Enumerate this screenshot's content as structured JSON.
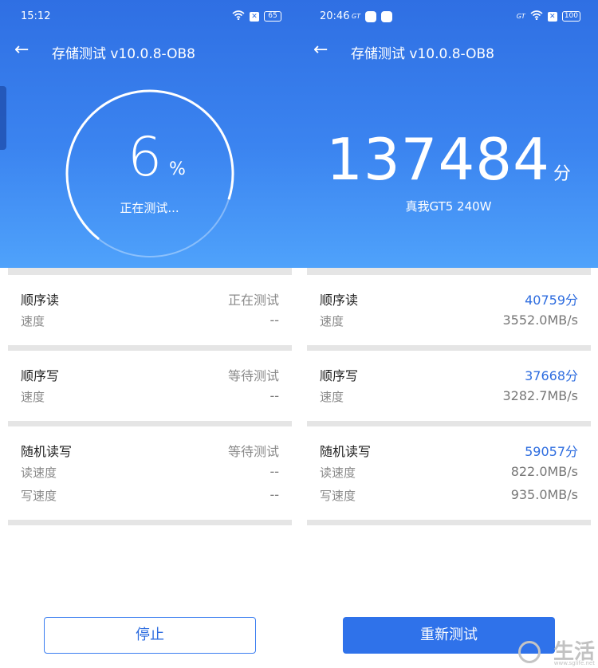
{
  "left": {
    "status_time": "15:12",
    "battery": "65",
    "title": "存储测试 v10.0.8-OB8",
    "progress_value": "6",
    "progress_unit": "%",
    "progress_fraction": 0.06,
    "testing_text": "正在测试...",
    "cards": [
      {
        "name": "顺序读",
        "status": "正在测试",
        "rows": [
          {
            "label": "速度",
            "value": "--"
          }
        ]
      },
      {
        "name": "顺序写",
        "status": "等待测试",
        "rows": [
          {
            "label": "速度",
            "value": "--"
          }
        ]
      },
      {
        "name": "随机读写",
        "status": "等待测试",
        "rows": [
          {
            "label": "读速度",
            "value": "--"
          },
          {
            "label": "写速度",
            "value": "--"
          }
        ]
      }
    ],
    "button_label": "停止"
  },
  "right": {
    "status_time": "20:46",
    "battery": "100",
    "title": "存储测试 v10.0.8-OB8",
    "total_score": "137484",
    "score_unit": "分",
    "device_name": "真我GT5 240W",
    "cards": [
      {
        "name": "顺序读",
        "score": "40759分",
        "rows": [
          {
            "label": "速度",
            "value": "3552.0MB/s"
          }
        ]
      },
      {
        "name": "顺序写",
        "score": "37668分",
        "rows": [
          {
            "label": "速度",
            "value": "3282.7MB/s"
          }
        ]
      },
      {
        "name": "随机读写",
        "score": "59057分",
        "rows": [
          {
            "label": "读速度",
            "value": "822.0MB/s"
          },
          {
            "label": "写速度",
            "value": "935.0MB/s"
          }
        ]
      }
    ],
    "button_label": "重新测试"
  },
  "watermark": {
    "text": "生活",
    "site": "www.sglife.net"
  },
  "colors": {
    "accent": "#2f72ea",
    "header_top": "#2f6fe3",
    "header_bottom": "#4fa2fb"
  },
  "icons": {
    "back": "arrow-left-icon",
    "wifi": "wifi-icon",
    "battery": "battery-icon",
    "mute": "notification-icon"
  }
}
